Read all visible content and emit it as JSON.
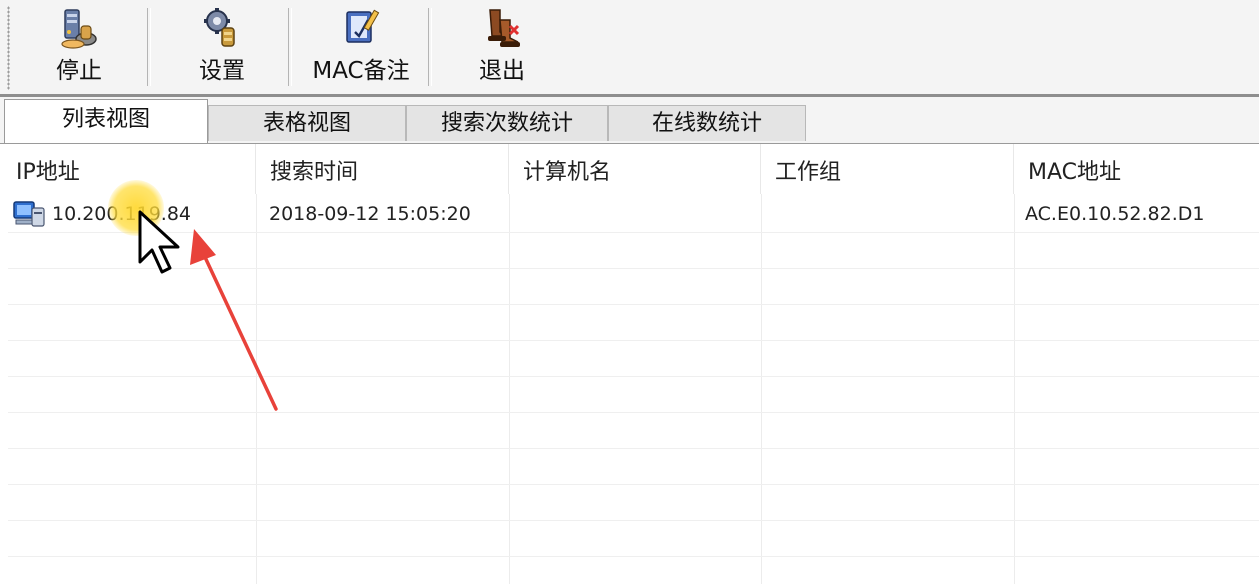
{
  "toolbar": {
    "buttons": [
      {
        "label": "停止",
        "icon": "stop-server-icon"
      },
      {
        "label": "设置",
        "icon": "settings-gear-icon"
      },
      {
        "label": "MAC备注",
        "icon": "mac-note-icon"
      },
      {
        "label": "退出",
        "icon": "exit-boots-icon"
      }
    ]
  },
  "tabs": [
    {
      "label": "列表视图",
      "active": true
    },
    {
      "label": "表格视图",
      "active": false
    },
    {
      "label": "搜索次数统计",
      "active": false
    },
    {
      "label": "在线数统计",
      "active": false
    }
  ],
  "list": {
    "columns": [
      "IP地址",
      "搜索时间",
      "计算机名",
      "工作组",
      "MAC地址"
    ],
    "rows": [
      {
        "ip": "10.200.119.84",
        "time": "2018-09-12 15:05:20",
        "computer": "",
        "workgroup": "",
        "mac": "AC.E0.10.52.82.D1",
        "icon": "network-computer-icon"
      }
    ]
  },
  "overlay": {
    "cursor_icon": "mouse-pointer-icon",
    "annotation_arrow_color": "#e8423a",
    "click_highlight_color": "#ffd83a"
  }
}
